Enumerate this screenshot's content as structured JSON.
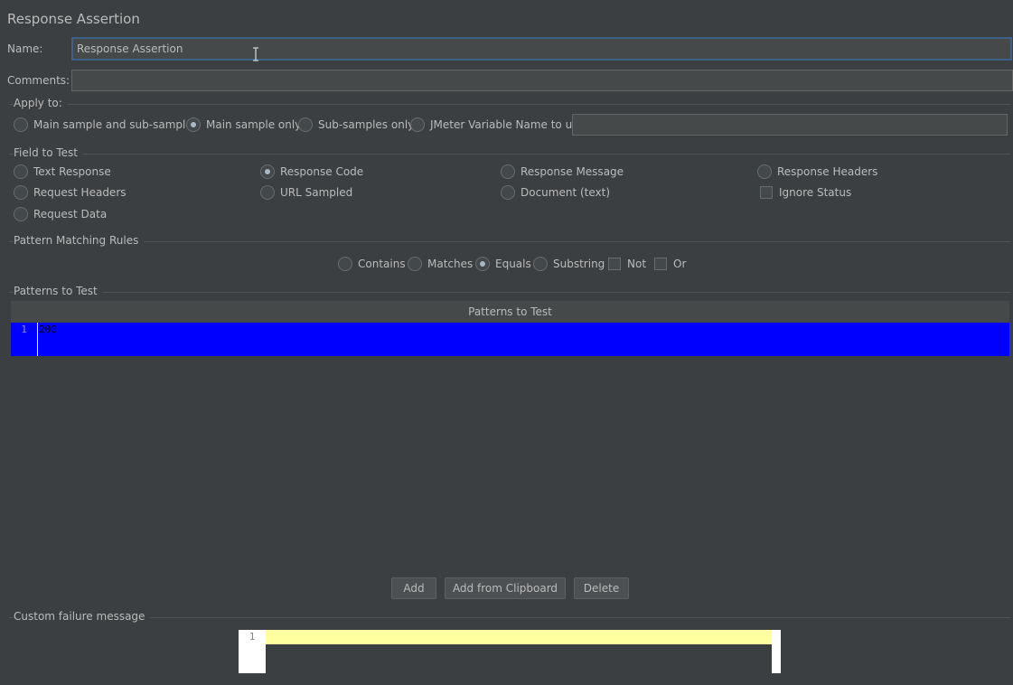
{
  "title": "Response Assertion",
  "name": {
    "label": "Name:",
    "value": "Response Assertion"
  },
  "comments": {
    "label": "Comments:",
    "value": ""
  },
  "apply_to": {
    "title": "Apply to:",
    "options": [
      {
        "label": "Main sample and sub-samples",
        "checked": false
      },
      {
        "label": "Main sample only",
        "checked": true
      },
      {
        "label": "Sub-samples only",
        "checked": false
      },
      {
        "label": "JMeter Variable Name to use",
        "checked": false
      }
    ],
    "variable_value": ""
  },
  "field_to_test": {
    "title": "Field to Test",
    "options": [
      {
        "label": "Text Response",
        "checked": false
      },
      {
        "label": "Response Code",
        "checked": true
      },
      {
        "label": "Response Message",
        "checked": false
      },
      {
        "label": "Response Headers",
        "checked": false
      },
      {
        "label": "Request Headers",
        "checked": false
      },
      {
        "label": "URL Sampled",
        "checked": false
      },
      {
        "label": "Document (text)",
        "checked": false
      },
      {
        "label": "Request Data",
        "checked": false
      }
    ],
    "ignore_status": {
      "label": "Ignore Status",
      "checked": false
    }
  },
  "pattern_matching": {
    "title": "Pattern Matching Rules",
    "options": [
      {
        "label": "Contains",
        "checked": false
      },
      {
        "label": "Matches",
        "checked": false
      },
      {
        "label": "Equals",
        "checked": true
      },
      {
        "label": "Substring",
        "checked": false
      }
    ],
    "not": {
      "label": "Not",
      "checked": false
    },
    "or": {
      "label": "Or",
      "checked": false
    }
  },
  "patterns": {
    "title": "Patterns to Test",
    "column_header": "Patterns to Test",
    "rows": [
      {
        "line": "1",
        "value": "200"
      }
    ],
    "row_color": "#0000ff"
  },
  "buttons": {
    "add": "Add",
    "add_clipboard": "Add from Clipboard",
    "delete": "Delete"
  },
  "failure": {
    "title": "Custom failure message",
    "line": "1",
    "value": ""
  },
  "colors": {
    "background": "#3c3f41",
    "focus_border": "#3d6185",
    "highlight_line": "#ffffa0"
  }
}
